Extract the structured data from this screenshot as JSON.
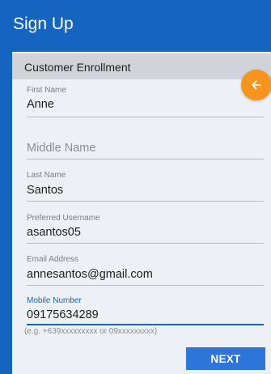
{
  "app_bar": {
    "title": "Sign Up"
  },
  "card": {
    "header_title": "Customer Enrollment"
  },
  "fab": {
    "icon": "arrow-left-icon",
    "color": "#f7941d"
  },
  "form": {
    "first_name": {
      "label": "First Name",
      "value": "Anne"
    },
    "middle_name": {
      "placeholder": "Middle Name",
      "value": ""
    },
    "last_name": {
      "label": "Last Name",
      "value": "Santos"
    },
    "username": {
      "label": "Preferred Username",
      "value": "asantos05"
    },
    "email": {
      "label": "Email Address",
      "value": "annesantos@gmail.com"
    },
    "mobile": {
      "label": "Mobile Number",
      "value": "09175634289",
      "hint": "(e.g. +639xxxxxxxxx or 09xxxxxxxxx)"
    }
  },
  "actions": {
    "next_label": "NEXT"
  },
  "colors": {
    "primary": "#1565c0",
    "accent": "#f7941d",
    "button": "#2f74d9"
  }
}
